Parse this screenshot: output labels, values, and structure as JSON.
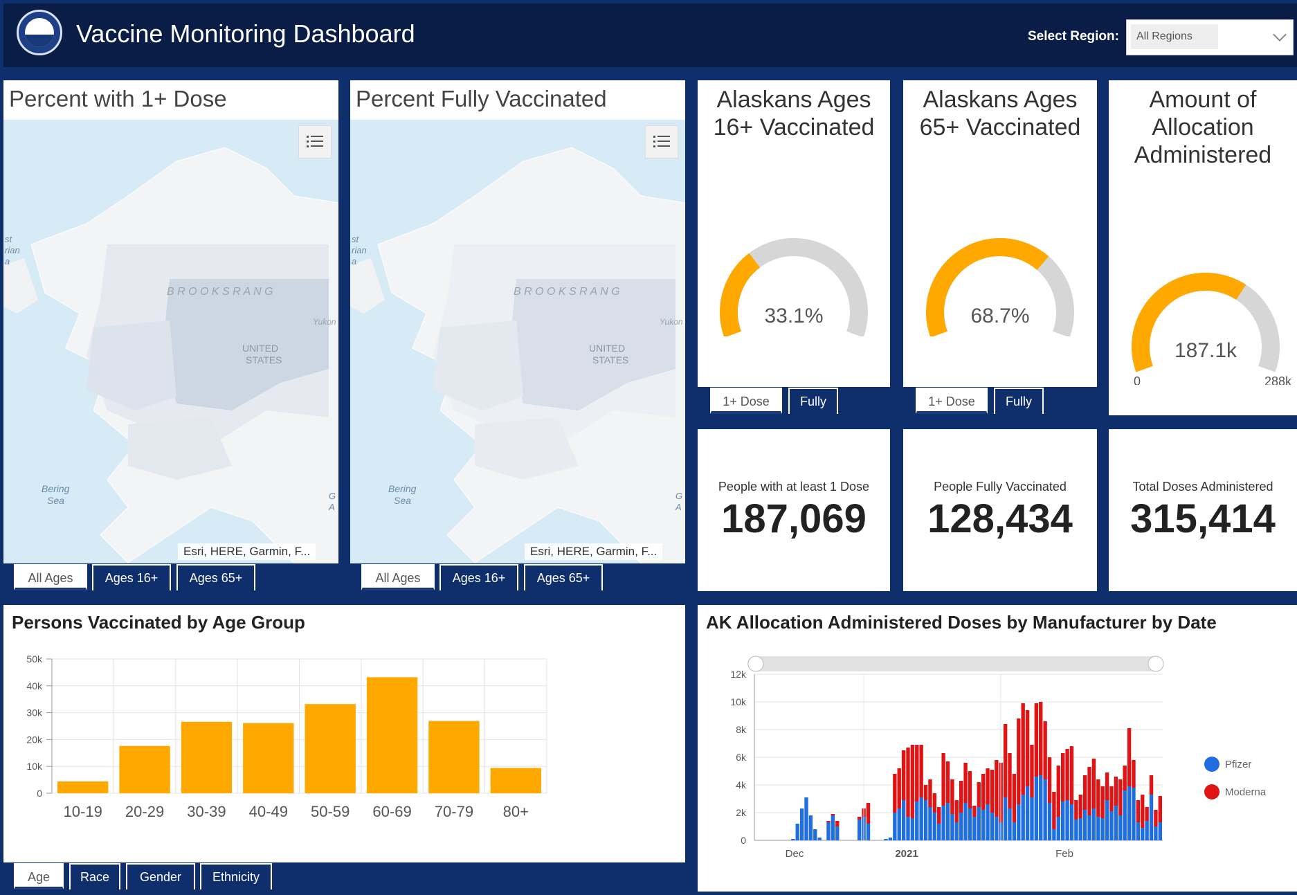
{
  "header": {
    "title": "Vaccine Monitoring Dashboard",
    "region_label": "Select Region:",
    "region_value": "All Regions"
  },
  "maps": [
    {
      "title": "Percent with 1+ Dose",
      "attribution": "Esri, HERE, Garmin, F...",
      "labels": {
        "brooks": "B R O O K S   R A N G",
        "us1": "UNITED",
        "us2": "STATES",
        "bering1": "Bering",
        "bering2": "Sea",
        "east1": "st",
        "east2": "rian",
        "east3": "a",
        "yukon": "Yukon",
        "g1": "G",
        "g2": "A"
      },
      "tabs": [
        "All Ages",
        "Ages 16+",
        "Ages 65+"
      ]
    },
    {
      "title": "Percent Fully Vaccinated",
      "attribution": "Esri, HERE, Garmin, F...",
      "labels": {
        "brooks": "B R O O K S   R A N G",
        "us1": "UNITED",
        "us2": "STATES",
        "bering1": "Bering",
        "bering2": "Sea",
        "east1": "st",
        "east2": "rian",
        "east3": "a",
        "yukon": "Yukon",
        "g1": "G",
        "g2": "A"
      },
      "tabs": [
        "All Ages",
        "Ages 16+",
        "Ages 65+"
      ]
    }
  ],
  "gauges": [
    {
      "title_l1": "Alaskans Ages",
      "title_l2": "16+ Vaccinated",
      "value_text": "33.1%",
      "fraction": 0.331,
      "tabs": [
        "1+ Dose",
        "Fully"
      ]
    },
    {
      "title_l1": "Alaskans Ages",
      "title_l2": "65+ Vaccinated",
      "value_text": "68.7%",
      "fraction": 0.687,
      "tabs": [
        "1+ Dose",
        "Fully"
      ]
    },
    {
      "title_l1": "Amount of",
      "title_l2": "Allocation",
      "title_l3": "Administered",
      "value_text": "187.1k",
      "fraction": 0.65,
      "min_label": "0",
      "max_label": "288k"
    }
  ],
  "kpis": [
    {
      "label": "People with at least 1 Dose",
      "value": "187,069"
    },
    {
      "label": "People Fully Vaccinated",
      "value": "128,434"
    },
    {
      "label": "Total Doses Administered",
      "value": "315,414"
    }
  ],
  "colors": {
    "accent": "#ffa800",
    "gauge_bg": "#d6d6d6",
    "pfizer": "#1f6fe0",
    "moderna": "#e01414",
    "navy": "#0e2e6c"
  },
  "age_chart": {
    "title": "Persons Vaccinated by Age Group",
    "tabs": [
      "Age",
      "Race",
      "Gender",
      "Ethnicity"
    ]
  },
  "mfr_chart": {
    "title": "AK Allocation Administered Doses by Manufacturer by Date"
  },
  "chart_data": [
    {
      "type": "bar",
      "title": "Persons Vaccinated by Age Group",
      "categories": [
        "10-19",
        "20-29",
        "30-39",
        "40-49",
        "50-59",
        "60-69",
        "70-79",
        "80+"
      ],
      "values": [
        4400,
        17600,
        26600,
        26100,
        33200,
        43200,
        26900,
        9400
      ],
      "ylim": [
        0,
        50000
      ],
      "yticks": [
        "0",
        "10k",
        "20k",
        "30k",
        "40k",
        "50k"
      ],
      "grid": true
    },
    {
      "type": "bar",
      "title": "AK Allocation Administered Doses by Manufacturer by Date",
      "stacked": true,
      "xticks": [
        "Dec",
        "2021",
        "Feb"
      ],
      "yticks": [
        "0",
        "2k",
        "4k",
        "6k",
        "8k",
        "10k",
        "12k"
      ],
      "ylim": [
        0,
        12000
      ],
      "legend": "right",
      "series": [
        {
          "name": "Pfizer",
          "values": [
            0,
            0,
            0,
            0,
            0,
            0,
            0,
            0,
            100,
            1200,
            2300,
            3100,
            1800,
            800,
            200,
            0,
            1300,
            1800,
            1000,
            0,
            0,
            0,
            0,
            1500,
            1700,
            1200,
            0,
            0,
            0,
            100,
            200,
            2000,
            2300,
            2900,
            1700,
            1600,
            2800,
            3100,
            2900,
            2400,
            2000,
            1200,
            2500,
            2700,
            1900,
            1300,
            2000,
            2700,
            2300,
            1700,
            2400,
            2200,
            2600,
            2000,
            1700,
            1300,
            3100,
            2300,
            1300,
            2600,
            3300,
            3900,
            3100,
            4600,
            4700,
            4400,
            2700,
            800,
            1700,
            2800,
            2900,
            2600,
            1500,
            1600,
            2200,
            1800,
            2300,
            1700,
            1600,
            2900,
            2100,
            2500,
            1800,
            3600,
            3900,
            3800,
            1300,
            900,
            1400,
            3300,
            1000,
            1300
          ]
        },
        {
          "name": "Moderna",
          "values": [
            0,
            0,
            0,
            0,
            0,
            0,
            0,
            0,
            0,
            0,
            0,
            0,
            0,
            0,
            0,
            0,
            100,
            100,
            400,
            0,
            0,
            0,
            0,
            200,
            600,
            1500,
            0,
            0,
            0,
            0,
            0,
            2800,
            2900,
            3600,
            5000,
            5300,
            4100,
            3800,
            1100,
            2000,
            1400,
            1200,
            3800,
            3000,
            2500,
            1600,
            2300,
            2900,
            2700,
            800,
            1800,
            2600,
            2600,
            3100,
            4100,
            4300,
            5300,
            4000,
            3500,
            6200,
            6600,
            5500,
            3800,
            5300,
            5300,
            4200,
            3300,
            2700,
            3700,
            3500,
            3700,
            4200,
            1400,
            1700,
            2500,
            3500,
            3600,
            2700,
            2300,
            2000,
            1800,
            2100,
            2600,
            1800,
            4200,
            2000,
            1600,
            2400,
            1000,
            1400,
            1200,
            1900
          ]
        }
      ]
    }
  ]
}
